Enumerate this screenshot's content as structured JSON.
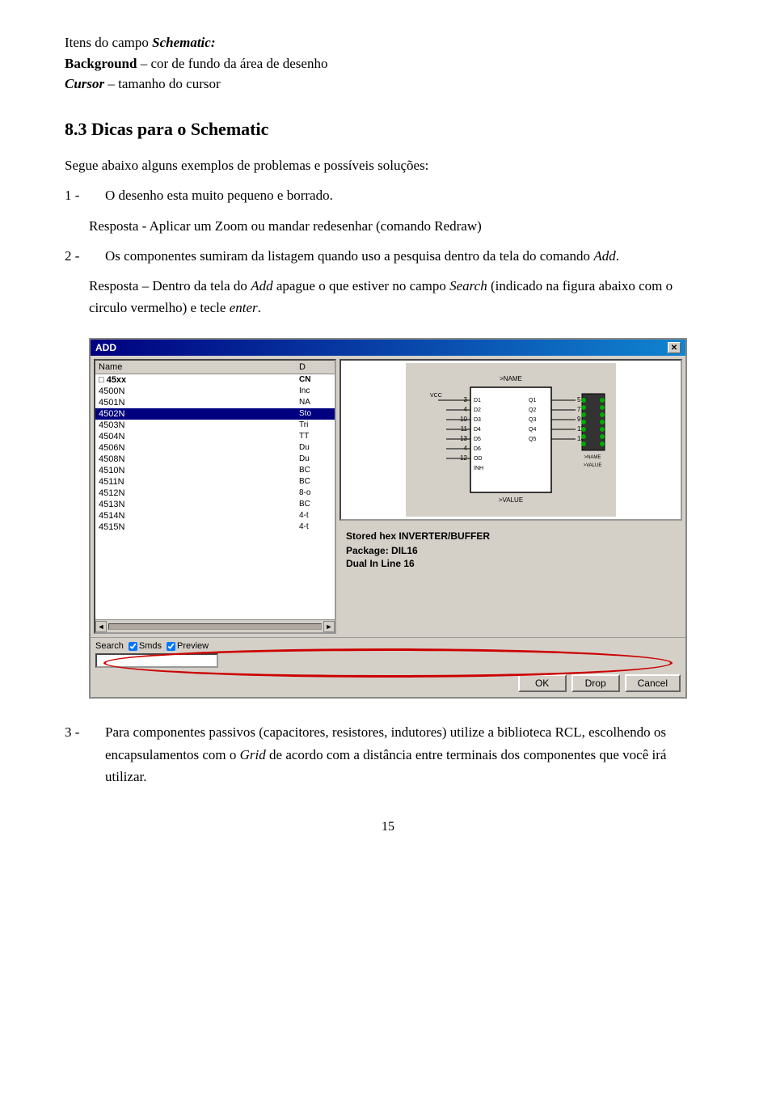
{
  "intro": {
    "line1": "Itens do campo ",
    "line1_italic": "Schematic:",
    "line2_bold": "Background",
    "line2_rest": " – cor de fundo da área de desenho",
    "line3_italic": "Cursor",
    "line3_rest": " – tamanho do cursor"
  },
  "section": {
    "heading": "8.3 Dicas para o Schematic",
    "intro_para": "Segue abaixo alguns exemplos de problemas e possíveis soluções:",
    "item1_num": "1 -",
    "item1_text": "O desenho esta muito pequeno e borrado.",
    "resposta1": "Resposta - Aplicar um Zoom ou mandar redesenhar (comando Redraw)",
    "item2_num": "2 -",
    "item2_text": "Os componentes sumiram da listagem quando uso a pesquisa dentro da tela do comando ",
    "item2_italic": "Add",
    "item2_end": ".",
    "resposta2_start": "Resposta – Dentro da tela do ",
    "resposta2_italic": "Add",
    "resposta2_mid": " apague o que estiver no campo ",
    "resposta2_search": "Search",
    "resposta2_end": " (indicado na figura abaixo com o circulo vermelho) e tecle ",
    "resposta2_enter": "enter",
    "resposta2_period": ".",
    "item3_num": "3 -",
    "item3_text": "Para componentes passivos (capacitores, resistores, indutores) utilize a biblioteca RCL, escolhendo os encapsulamentos com o ",
    "item3_italic": "Grid",
    "item3_end": " de acordo com a distância entre terminais dos componentes que você irá utilizar."
  },
  "dialog": {
    "title": "ADD",
    "close_btn": "✕",
    "col_name": "Name",
    "col_d": "D",
    "rows": [
      {
        "name": "□  45xx",
        "d": "CN",
        "selected": false,
        "group": true,
        "indent": 0
      },
      {
        "name": "   4500N",
        "d": "Inc",
        "selected": false,
        "group": false,
        "indent": 1
      },
      {
        "name": "   4501N",
        "d": "NA",
        "selected": false,
        "group": false,
        "indent": 1
      },
      {
        "name": "   4502N",
        "d": "Sto",
        "selected": true,
        "group": false,
        "indent": 1
      },
      {
        "name": "   4503N",
        "d": "Tri",
        "selected": false,
        "group": false,
        "indent": 1
      },
      {
        "name": "   4504N",
        "d": "TT",
        "selected": false,
        "group": false,
        "indent": 1
      },
      {
        "name": "   4506N",
        "d": "Du",
        "selected": false,
        "group": false,
        "indent": 1
      },
      {
        "name": "   4508N",
        "d": "Du",
        "selected": false,
        "group": false,
        "indent": 1
      },
      {
        "name": "   4510N",
        "d": "BC",
        "selected": false,
        "group": false,
        "indent": 1
      },
      {
        "name": "   4511N",
        "d": "BC",
        "selected": false,
        "group": false,
        "indent": 1
      },
      {
        "name": "   4512N",
        "d": "8-o",
        "selected": false,
        "group": false,
        "indent": 1
      },
      {
        "name": "   4513N",
        "d": "BC",
        "selected": false,
        "group": false,
        "indent": 1
      },
      {
        "name": "   4514N",
        "d": "4-t",
        "selected": false,
        "group": false,
        "indent": 1
      },
      {
        "name": "   4515N",
        "d": "4-t",
        "selected": false,
        "group": false,
        "indent": 1
      }
    ],
    "chip_title": "Stored hex INVERTER/BUFFER",
    "chip_package": "Package: DIL16",
    "chip_dual": "Dual In Line 16",
    "search_label": "Search",
    "smds_label": "Smds",
    "preview_label": "Preview",
    "ok_btn": "OK",
    "drop_btn": "Drop",
    "cancel_btn": "Cancel"
  },
  "page_number": "15"
}
